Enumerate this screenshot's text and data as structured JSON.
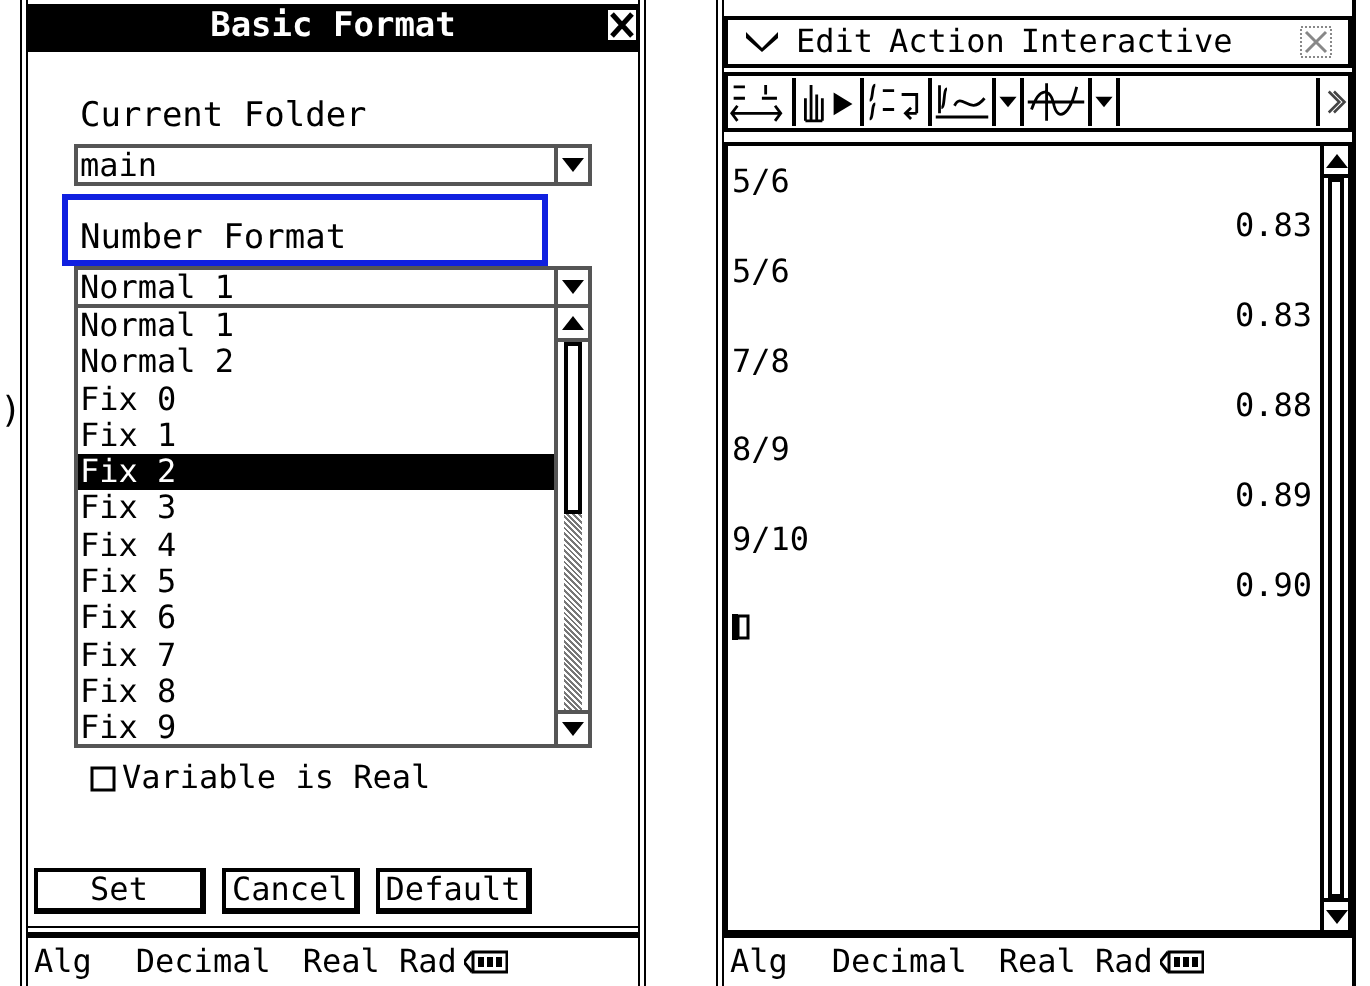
{
  "edge_fragment": ")",
  "dialog": {
    "title": "Basic Format",
    "fields": [
      {
        "label": "Current Folder",
        "value": "main",
        "highlighted": false
      },
      {
        "label": "Number Format",
        "value": "Normal 1",
        "highlighted": true
      }
    ],
    "options": [
      {
        "label": "Normal 1",
        "selected": false
      },
      {
        "label": "Normal 2",
        "selected": false
      },
      {
        "label": "Fix 0",
        "selected": false
      },
      {
        "label": "Fix 1",
        "selected": false
      },
      {
        "label": "Fix 2",
        "selected": true
      },
      {
        "label": "Fix 3",
        "selected": false
      },
      {
        "label": "Fix 4",
        "selected": false
      },
      {
        "label": "Fix 5",
        "selected": false
      },
      {
        "label": "Fix 6",
        "selected": false
      },
      {
        "label": "Fix 7",
        "selected": false
      },
      {
        "label": "Fix 8",
        "selected": false
      },
      {
        "label": "Fix 9",
        "selected": false
      }
    ],
    "checkbox": {
      "label": "Variable is Real",
      "checked": false
    },
    "buttons": [
      "Set",
      "Cancel",
      "Default"
    ]
  },
  "left_status_bar": [
    "Alg",
    "Decimal",
    "Real Rad"
  ],
  "main_app": {
    "menu": [
      "Edit",
      "Action",
      "Interactive"
    ],
    "history": [
      {
        "input": "5/6",
        "result": "0.83"
      },
      {
        "input": "5/6",
        "result": "0.83"
      },
      {
        "input": "7/8",
        "result": "0.88"
      },
      {
        "input": "8/9",
        "result": "0.89"
      },
      {
        "input": "9/10",
        "result": "0.90"
      }
    ]
  },
  "right_status_bar": [
    "Alg",
    "Decimal",
    "Real Rad"
  ]
}
